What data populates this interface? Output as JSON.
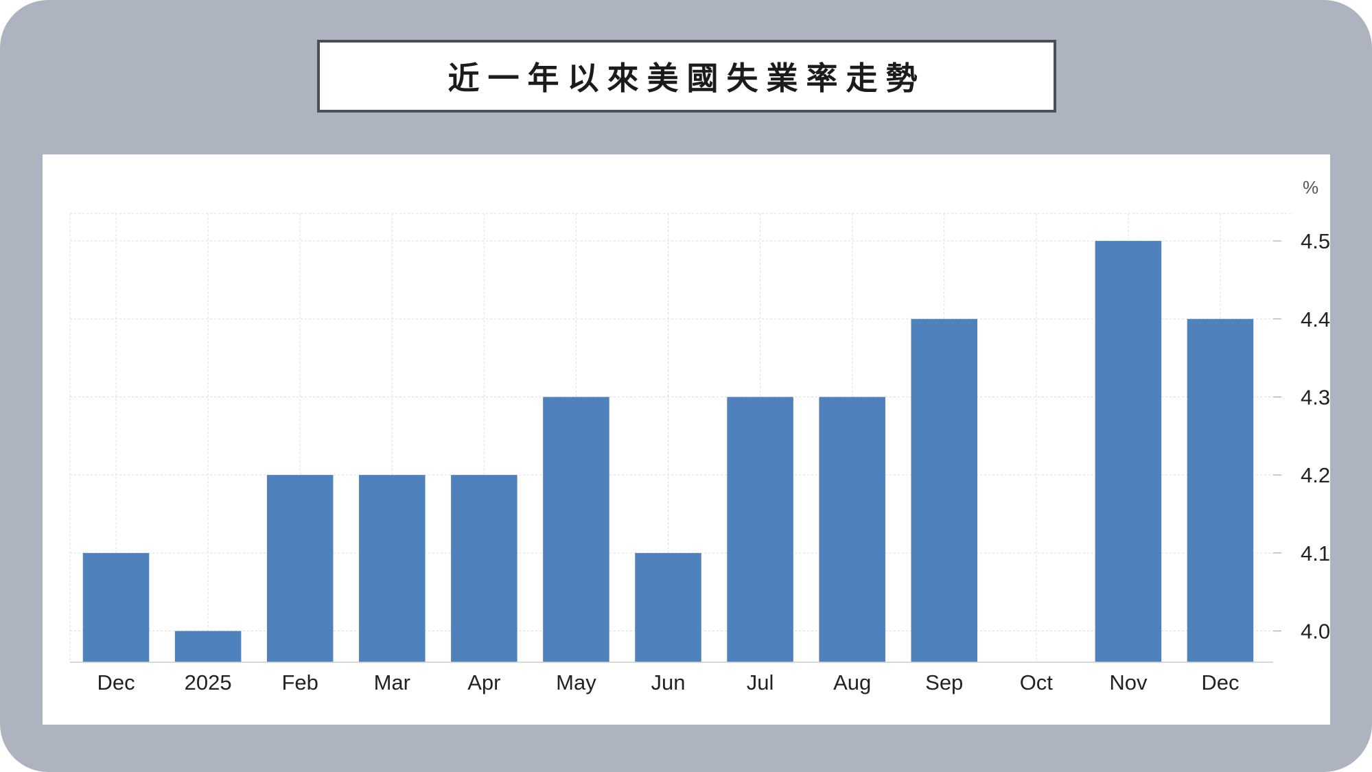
{
  "title": "近一年以來美國失業率走勢",
  "colors": {
    "frame": "#aeb4bf",
    "bar": "#4f81bd",
    "grid": "#dddddd",
    "text": "#222222"
  },
  "chart_data": {
    "type": "bar",
    "title": "近一年以來美國失業率走勢",
    "xlabel": "",
    "ylabel": "",
    "unit": "%",
    "categories": [
      "Dec",
      "2025",
      "Feb",
      "Mar",
      "Apr",
      "May",
      "Jun",
      "Jul",
      "Aug",
      "Sep",
      "Oct",
      "Nov",
      "Dec"
    ],
    "values": [
      4.1,
      4.0,
      4.2,
      4.2,
      4.2,
      4.3,
      4.1,
      4.3,
      4.3,
      4.4,
      null,
      4.5,
      4.4
    ],
    "ylim": [
      3.96,
      4.53
    ],
    "yticks": [
      4.0,
      4.1,
      4.2,
      4.3,
      4.4,
      4.5
    ],
    "ytick_labels": [
      "4.00",
      "4.10",
      "4.20",
      "4.30",
      "4.40",
      "4.50"
    ],
    "y_axis_position": "right",
    "grid": true
  }
}
